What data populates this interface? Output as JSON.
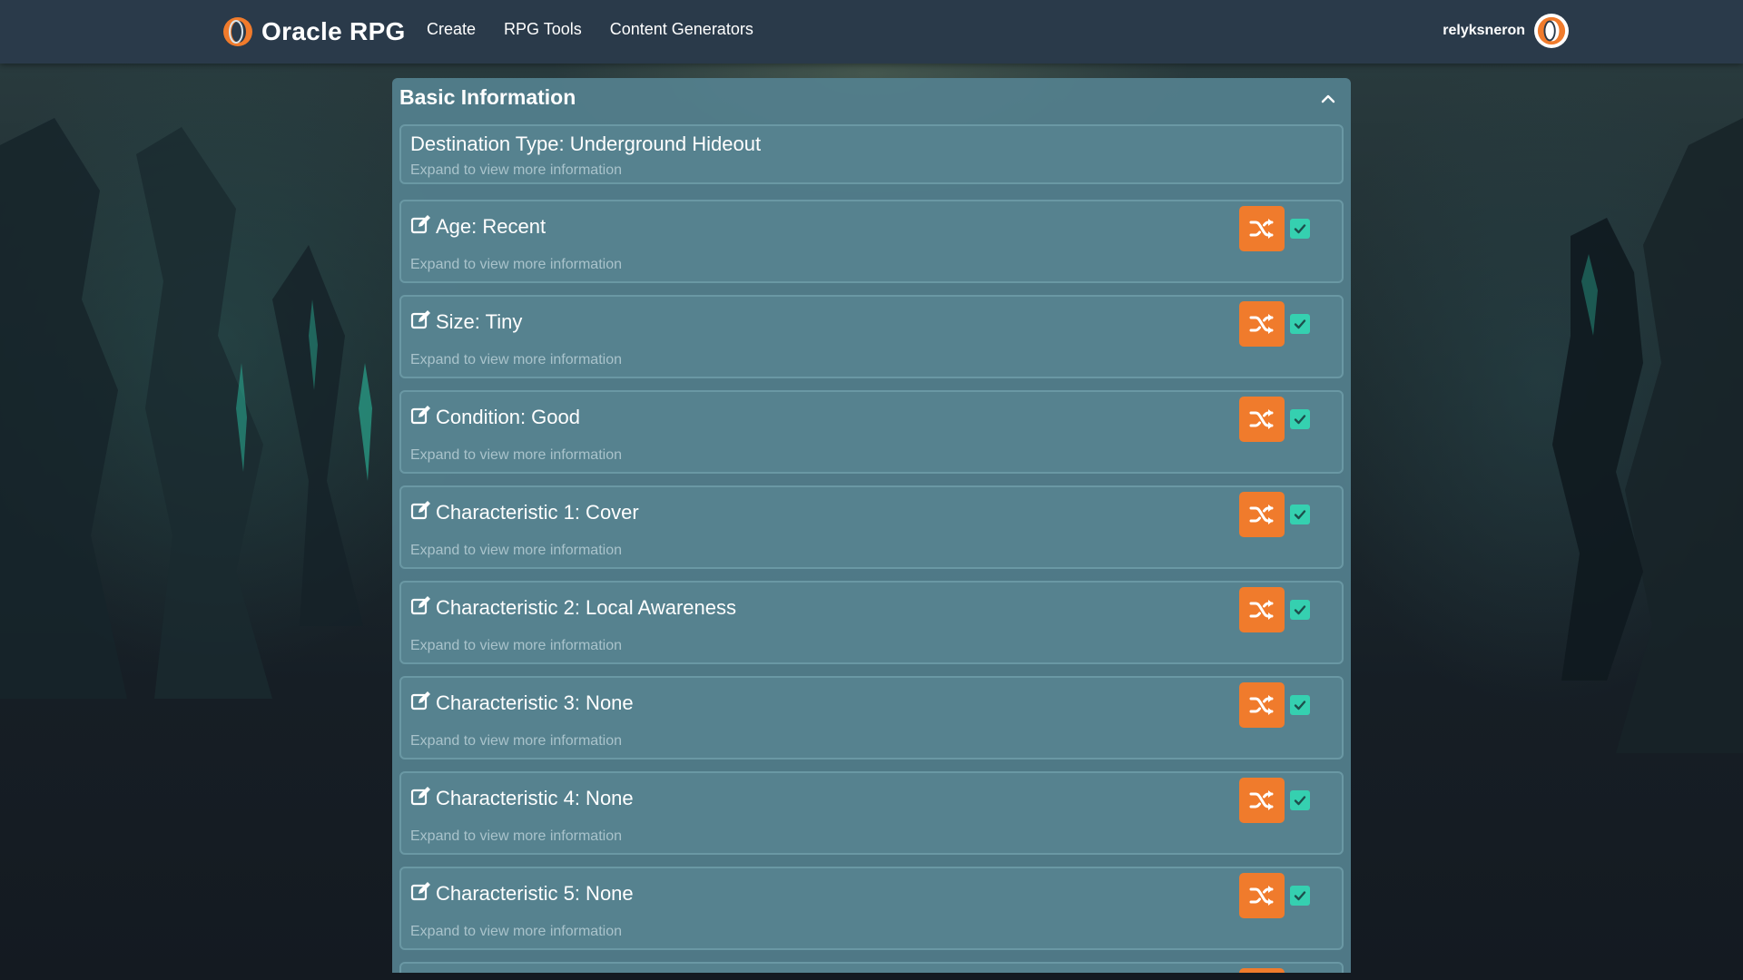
{
  "navbar": {
    "brand": "Oracle RPG",
    "links": [
      "Create",
      "RPG Tools",
      "Content Generators"
    ],
    "username": "relyksneron"
  },
  "panel": {
    "title": "Basic Information",
    "destination": {
      "title": "Destination Type: Underground Hideout",
      "subtitle": "Expand to view more information"
    },
    "attributes": [
      {
        "title": "Age: Recent",
        "subtitle": "Expand to view more information",
        "checked": true
      },
      {
        "title": "Size: Tiny",
        "subtitle": "Expand to view more information",
        "checked": true
      },
      {
        "title": "Condition: Good",
        "subtitle": "Expand to view more information",
        "checked": true
      },
      {
        "title": "Characteristic 1: Cover",
        "subtitle": "Expand to view more information",
        "checked": true
      },
      {
        "title": "Characteristic 2: Local Awareness",
        "subtitle": "Expand to view more information",
        "checked": true
      },
      {
        "title": "Characteristic 3: None",
        "subtitle": "Expand to view more information",
        "checked": true
      },
      {
        "title": "Characteristic 4: None",
        "subtitle": "Expand to view more information",
        "checked": true
      },
      {
        "title": "Characteristic 5: None",
        "subtitle": "Expand to view more information",
        "checked": true
      }
    ]
  },
  "colors": {
    "navbar": "#2a3a4a",
    "panel": "#54808e",
    "card": "#56828f",
    "shuffle_button": "#f07b2c",
    "checkbox": "#35d0b0",
    "subtitle_text": "#a9c3cb"
  },
  "icons": {
    "brand": "oracle-ring-logo-icon",
    "collapse": "chevron-up-icon",
    "edit": "edit-square-icon",
    "shuffle": "shuffle-icon",
    "check": "checkbox-checked-icon",
    "avatar": "oracle-ring-avatar-icon"
  }
}
